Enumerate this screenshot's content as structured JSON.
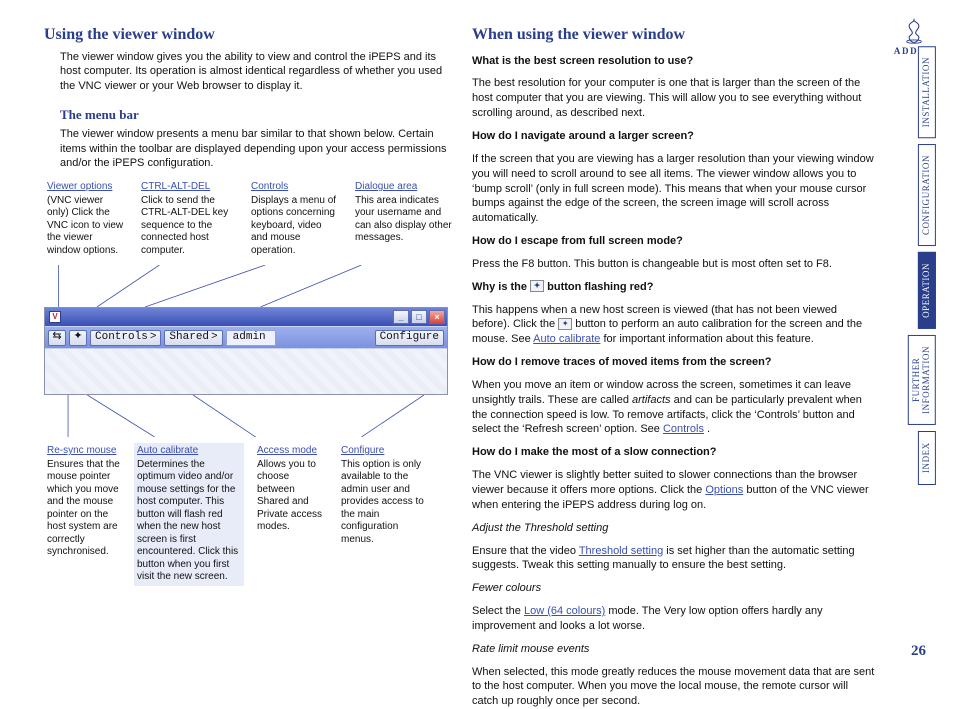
{
  "logo": {
    "brand": "ADDER"
  },
  "page_number": "26",
  "side_tabs": [
    {
      "label": "INSTALLATION",
      "active": false
    },
    {
      "label": "CONFIGURATION",
      "active": false
    },
    {
      "label": "OPERATION",
      "active": true
    },
    {
      "label": "FURTHER\nINFORMATION",
      "active": false
    },
    {
      "label": "INDEX",
      "active": false
    }
  ],
  "left": {
    "h1": "Using the viewer window",
    "intro": "The viewer window gives you the ability to view and control the iPEPS and its host computer. Its operation is almost identical regardless of whether you used the VNC viewer or your Web browser to display it.",
    "h2": "The menu bar",
    "menubar_intro": "The viewer window presents a menu bar similar to that shown below. Certain items within the toolbar are displayed depending upon your access permissions and/or the iPEPS configuration.",
    "callouts_top": [
      {
        "hd": "Viewer options",
        "body": "(VNC viewer only) Click the VNC icon to view the viewer window options.",
        "hl": false
      },
      {
        "hd": "CTRL-ALT-DEL",
        "body": "Click to send the CTRL-ALT-DEL key sequence to the connected host computer.",
        "hl": false
      },
      {
        "hd": "Controls",
        "body": "Displays a menu of options concerning keyboard, video and mouse operation.",
        "hl": false
      },
      {
        "hd": "Dialogue area",
        "body": "This area indicates your username and can also display other messages.",
        "hl": false
      }
    ],
    "toolbar": {
      "icon1": "V",
      "btn_controls": "Controls",
      "chevron": ">",
      "btn_shared": "Shared",
      "btn_admin": "admin",
      "btn_configure": "Configure"
    },
    "callouts_bottom": [
      {
        "hd": "Re-sync mouse",
        "body": "Ensures that the mouse pointer which you move and the mouse pointer on the host system are correctly synchronised.",
        "hl": false
      },
      {
        "hd": "Auto calibrate",
        "body": "Determines the optimum video and/or mouse settings for the host computer. This button will flash red when the new host screen is first encountered. Click this button when you first visit the new screen.",
        "hl": true
      },
      {
        "hd": "Access mode",
        "body": "Allows you to choose between Shared and Private access modes.",
        "hl": false
      },
      {
        "hd": "Configure",
        "body": "This option is only available to the admin user and provides access to the main configuration menus.",
        "hl": false
      }
    ]
  },
  "right": {
    "h1": "When using the viewer window",
    "q1": "What is the best screen resolution to use?",
    "a1": "The best resolution for your computer is one that is larger than the screen of the host computer that you are viewing. This will allow you to see everything without scrolling around, as described next.",
    "q2": "How do I navigate around a larger screen?",
    "a2": "If the screen that you are viewing has a larger resolution than your viewing window you will need to scroll around to see all items. The viewer window allows you to ‘bump scroll’ (only in full screen mode). This means that when your mouse cursor bumps against the edge of the screen, the screen image will scroll across automatically.",
    "q3": "How do I escape from full screen mode?",
    "a3": "Press the F8 button. This button is changeable but is most often set to F8.",
    "q4_pre": "Why is the ",
    "q4_post": " button flashing red?",
    "a4_pre": "This happens when a new host screen is viewed (that has not been viewed before). Click the ",
    "a4_mid": " button to perform an auto calibration for the screen and the mouse. See ",
    "a4_link": "Auto calibrate",
    "a4_post": " for important information about this feature.",
    "q5": "How do I remove traces of moved items from the screen?",
    "a5_pre": "When you move an item or window across the screen, sometimes it can leave unsightly trails. These are called ",
    "a5_em": "artifacts",
    "a5_mid": " and can be particularly prevalent when the connection speed is low. To remove artifacts, click the ‘Controls’ button and select the ‘Refresh screen’ option. See ",
    "a5_link": "Controls",
    "a5_post": ".",
    "q6": "How do I make the most of a slow connection?",
    "a6_pre": "The VNC viewer is slightly better suited to slower connections than the browser viewer because it offers more options. Click the ",
    "a6_link": "Options",
    "a6_post": " button of the VNC viewer when entering the iPEPS address during log on.",
    "sub1_h": "Adjust the Threshold setting",
    "sub1_pre": "Ensure that the video ",
    "sub1_link": "Threshold setting",
    "sub1_post": " is set higher than the automatic setting suggests. Tweak this setting manually to ensure the best setting.",
    "sub2_h": "Fewer colours",
    "sub2_pre": "Select the ",
    "sub2_link": "Low (64 colours)",
    "sub2_post": " mode. The Very low option offers hardly any improvement and looks a lot worse.",
    "sub3_h": "Rate limit mouse events",
    "sub3": "When selected, this mode greatly reduces the mouse movement data that are sent to the host computer. When you move the local mouse, the remote cursor will catch up roughly once per second."
  }
}
